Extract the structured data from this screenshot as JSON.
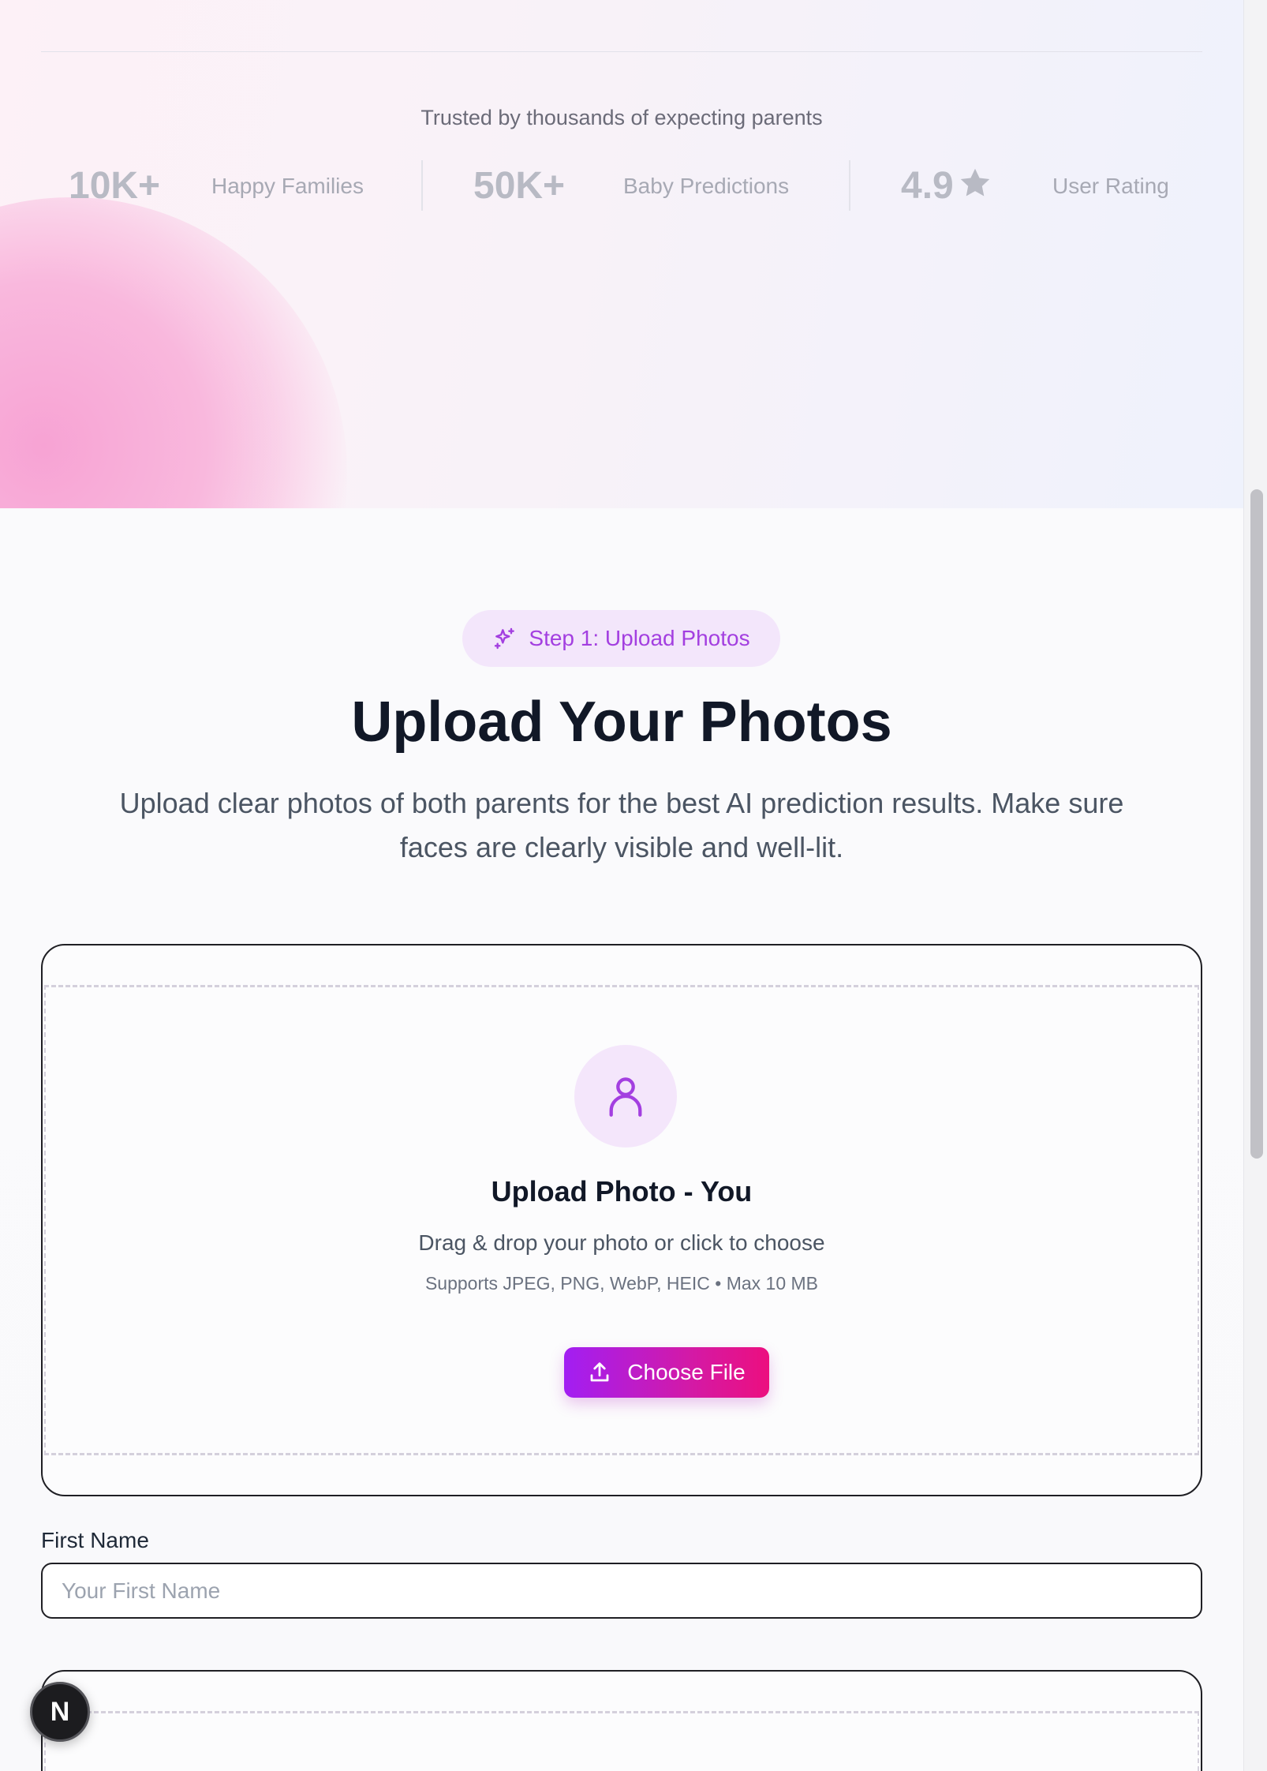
{
  "hero": {
    "trusted_text": "Trusted by thousands of expecting parents",
    "stats": [
      {
        "value": "10K+",
        "label": "Happy Families"
      },
      {
        "value": "50K+",
        "label": "Baby Predictions"
      },
      {
        "value": "4.9",
        "label": "User Rating",
        "icon": "star-icon"
      }
    ]
  },
  "upload_section": {
    "step_badge": "Step 1: Upload Photos",
    "step_icon": "sparkles-icon",
    "title": "Upload Your Photos",
    "description": "Upload clear photos of both parents for the best AI prediction results. Make sure faces are clearly visible and well-lit.",
    "cards": [
      {
        "icon": "user-icon",
        "title": "Upload Photo - You",
        "hint": "Drag & drop your photo or click to choose",
        "formats": "Supports JPEG, PNG, WebP, HEIC • Max 10 MB",
        "button_label": "Choose File",
        "button_icon": "upload-icon"
      }
    ],
    "first_name": {
      "label": "First Name",
      "placeholder": "Your First Name",
      "value": ""
    }
  },
  "floating_badge": {
    "label": "N"
  },
  "colors": {
    "accent_purple": "#a33fe0",
    "button_gradient_start": "#a21ef3",
    "button_gradient_end": "#ec0f7f",
    "pill_background": "#f3e6fb"
  }
}
